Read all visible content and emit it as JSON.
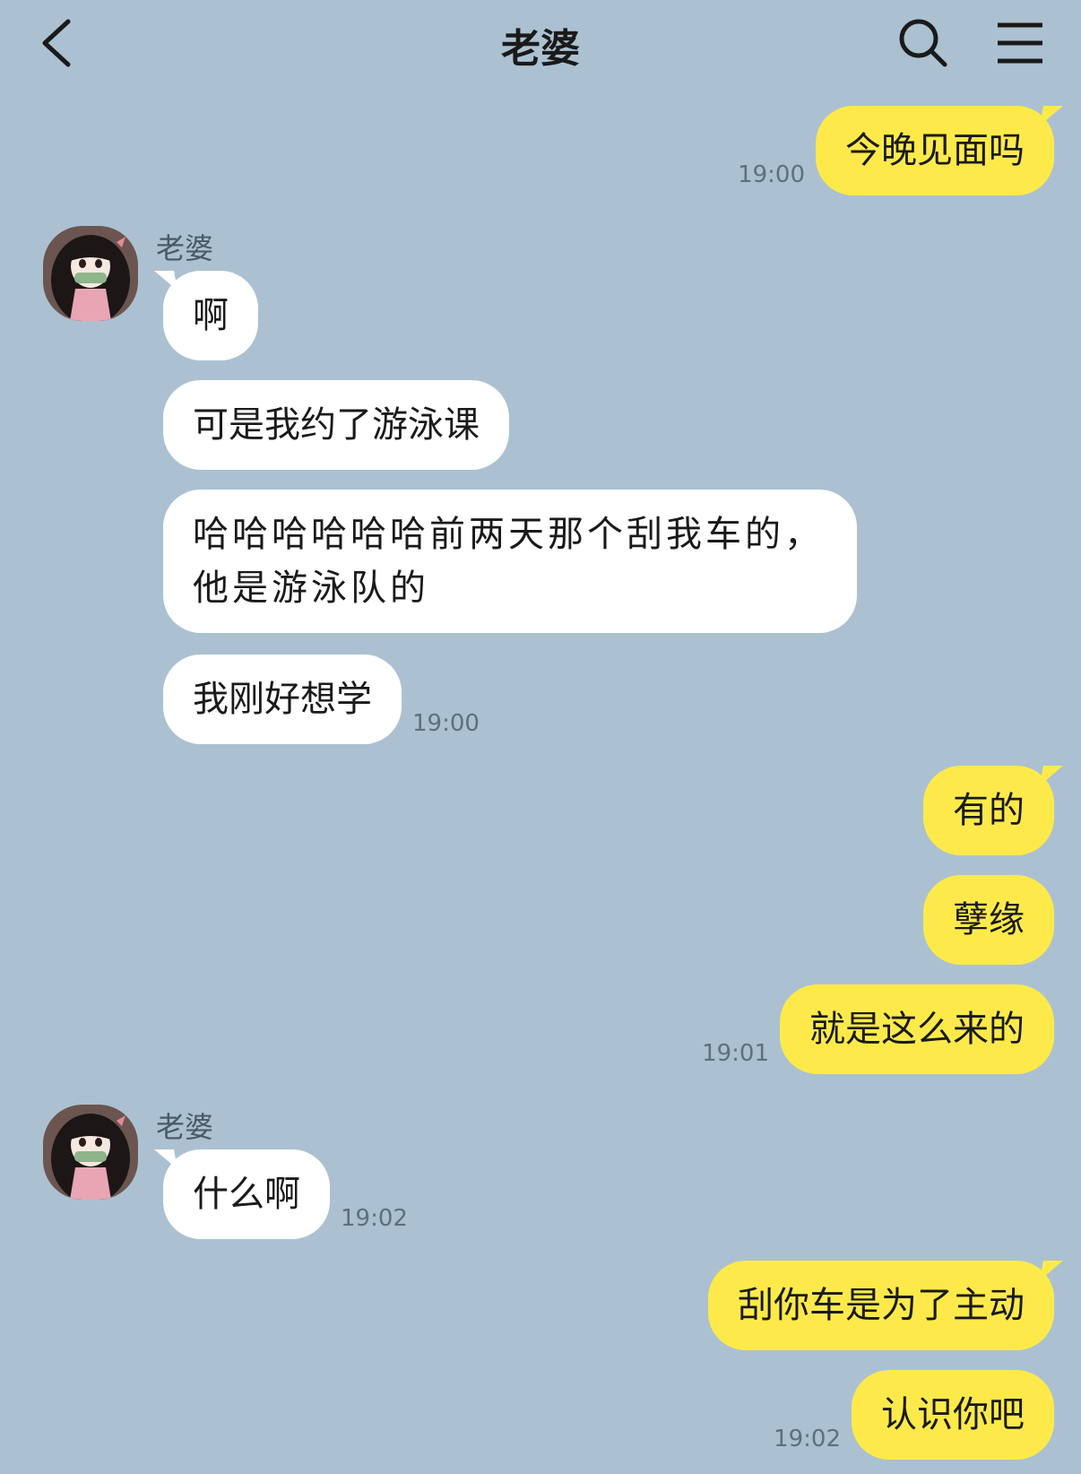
{
  "header": {
    "title": "老婆"
  },
  "icons": {
    "back": "back-chevron-icon",
    "search": "search-icon",
    "menu": "hamburger-menu-icon"
  },
  "colors": {
    "background": "#abc1d1",
    "sent_bubble": "#fdea4a",
    "received_bubble": "#ffffff",
    "timestamp": "#5f6f7c"
  },
  "messages": {
    "m1": {
      "text": "今晚见面吗",
      "time": "19:00"
    },
    "g1": {
      "sender": "老婆",
      "m2": {
        "text": "啊"
      },
      "m3": {
        "text": "可是我约了游泳课"
      },
      "m4": {
        "text": "哈哈哈哈哈哈前两天那个刮我车的，他是游泳队的"
      },
      "m5": {
        "text": "我刚好想学",
        "time": "19:00"
      }
    },
    "m6": {
      "text": "有的"
    },
    "m7": {
      "text": "孽缘"
    },
    "m8": {
      "text": "就是这么来的",
      "time": "19:01"
    },
    "g2": {
      "sender": "老婆",
      "m9": {
        "text": "什么啊",
        "time": "19:02"
      }
    },
    "m10": {
      "text": "刮你车是为了主动"
    },
    "m11": {
      "text": "认识你吧",
      "time": "19:02"
    }
  }
}
